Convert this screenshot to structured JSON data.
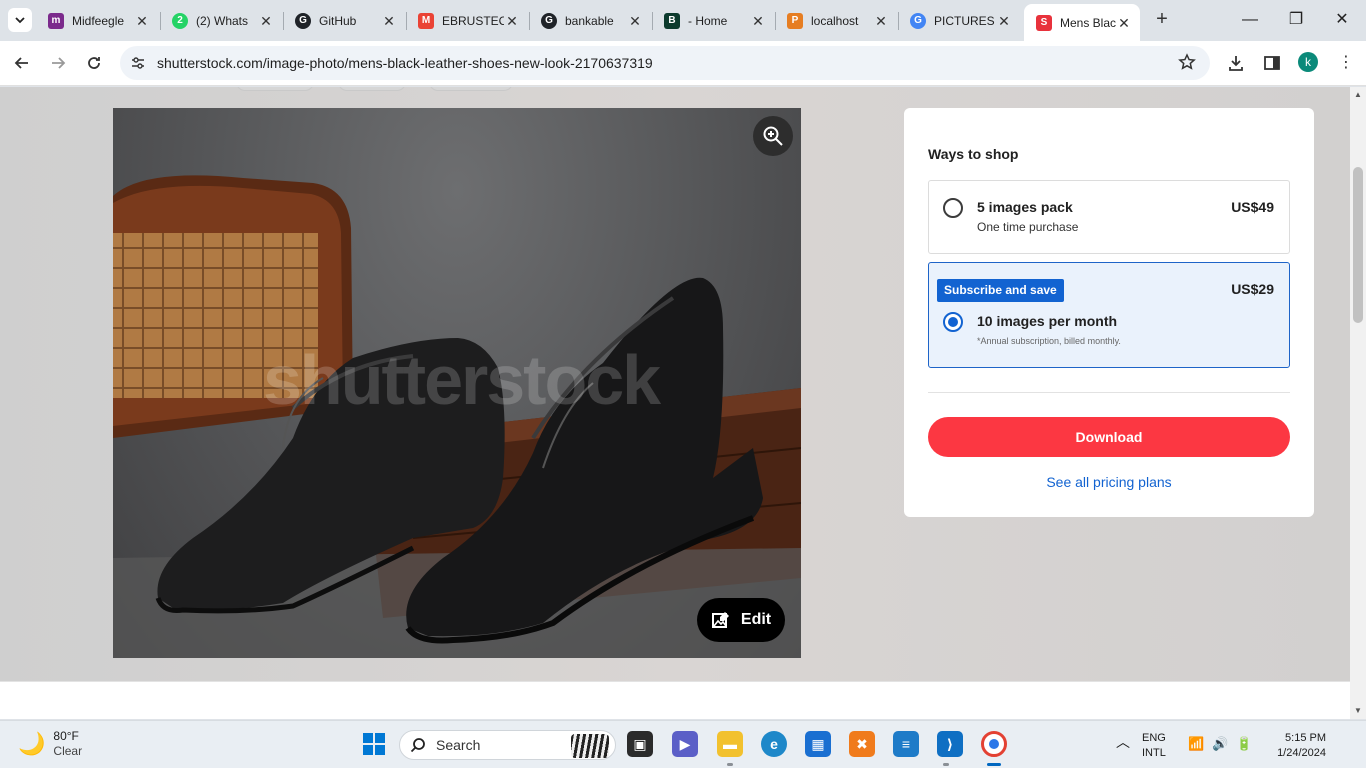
{
  "browser": {
    "tabs": [
      {
        "title": "Midfeegle",
        "favicon_color": "#7b2a8c",
        "favicon_char": "m"
      },
      {
        "title": "(2) Whats",
        "favicon_color": "#25d366",
        "favicon_char": "2"
      },
      {
        "title": "GitHub",
        "favicon_color": "#1f2328",
        "favicon_char": "G"
      },
      {
        "title": "EBRUSTEC",
        "favicon_color": "#ea4335",
        "favicon_char": "M"
      },
      {
        "title": "bankable",
        "favicon_color": "#1f2328",
        "favicon_char": "G"
      },
      {
        "title": "- Home",
        "favicon_color": "#0d3b2e",
        "favicon_char": "B"
      },
      {
        "title": "localhost",
        "favicon_color": "#e67e22",
        "favicon_char": "P"
      },
      {
        "title": "PICTURES",
        "favicon_color": "#4285f4",
        "favicon_char": "G"
      },
      {
        "title": "Mens Blac",
        "favicon_color": "#e8323c",
        "favicon_char": "S"
      }
    ],
    "url": "shutterstock.com/image-photo/mens-black-leather-shoes-new-look-2170637319",
    "profile_initial": "k"
  },
  "photo": {
    "watermark": "shutterstock",
    "edit_label": "Edit"
  },
  "shop": {
    "title": "Ways to shop",
    "option1": {
      "name": "5 images pack",
      "sub": "One time purchase",
      "price": "US$49"
    },
    "option2": {
      "badge": "Subscribe and save",
      "name": "10 images per month",
      "note": "*Annual subscription, billed monthly.",
      "price": "US$29"
    },
    "download_label": "Download",
    "pricing_link": "See all pricing plans"
  },
  "taskbar": {
    "weather_temp": "80°F",
    "weather_cond": "Clear",
    "search_label": "Search",
    "lang_top": "ENG",
    "lang_bottom": "INTL",
    "time": "5:15 PM",
    "date": "1/24/2024"
  }
}
